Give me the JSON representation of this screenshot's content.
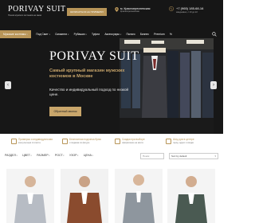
{
  "header": {
    "logo": "PORIVAY SUIT",
    "logo_sub": "Пошив мужских костюмов на заказ",
    "cta": "ЗАПИСАТЬСЯ НА ПРИМЕРКУ",
    "location": "м. Краснопресненская",
    "location_sub": "Краснопресненская",
    "phone": "+7 (965) 185-68-16",
    "hours": "ежедневно, с 10 до 22"
  },
  "nav": {
    "items": [
      {
        "label": "Мужские костюмы",
        "active": true
      },
      {
        "label": "Под Смит"
      },
      {
        "label": "Смокинги"
      },
      {
        "label": "Рубашки"
      },
      {
        "label": "Туфли"
      },
      {
        "label": "Аксессуары"
      },
      {
        "label": "Пальто"
      },
      {
        "label": "Бизнес"
      },
      {
        "label": "Premium"
      },
      {
        "label": "%"
      }
    ]
  },
  "hero": {
    "title": "PORIVAY SUIT",
    "heading": "Самый крупный магазин мужских костюмов в Москве",
    "desc": "Качество и индивидуальный подход по низкой цене.",
    "button": "Обратный звонок"
  },
  "features": [
    {
      "title": "Примерка и индивидуальная",
      "sub": "консультация стилиста"
    },
    {
      "title": "Бесплатная подгонка брюк",
      "sub": "и пиджака по фигуре"
    },
    {
      "title": "Скидки при выборе",
      "sub": "оформление на месте"
    },
    {
      "title": "Шоу-рум в центре",
      "sub": "город. адрес и скидки"
    }
  ],
  "filters": {
    "items": [
      "РАЗДЕЛ",
      "ЦВЕТ",
      "РАЗМЕР",
      "РОСТ",
      "УЗОР",
      "ЦЕНА"
    ],
    "search_placeholder": "Поиск",
    "sort": "Sort by default"
  },
  "colors": {
    "accent": "#b89558",
    "dark": "#161616"
  }
}
